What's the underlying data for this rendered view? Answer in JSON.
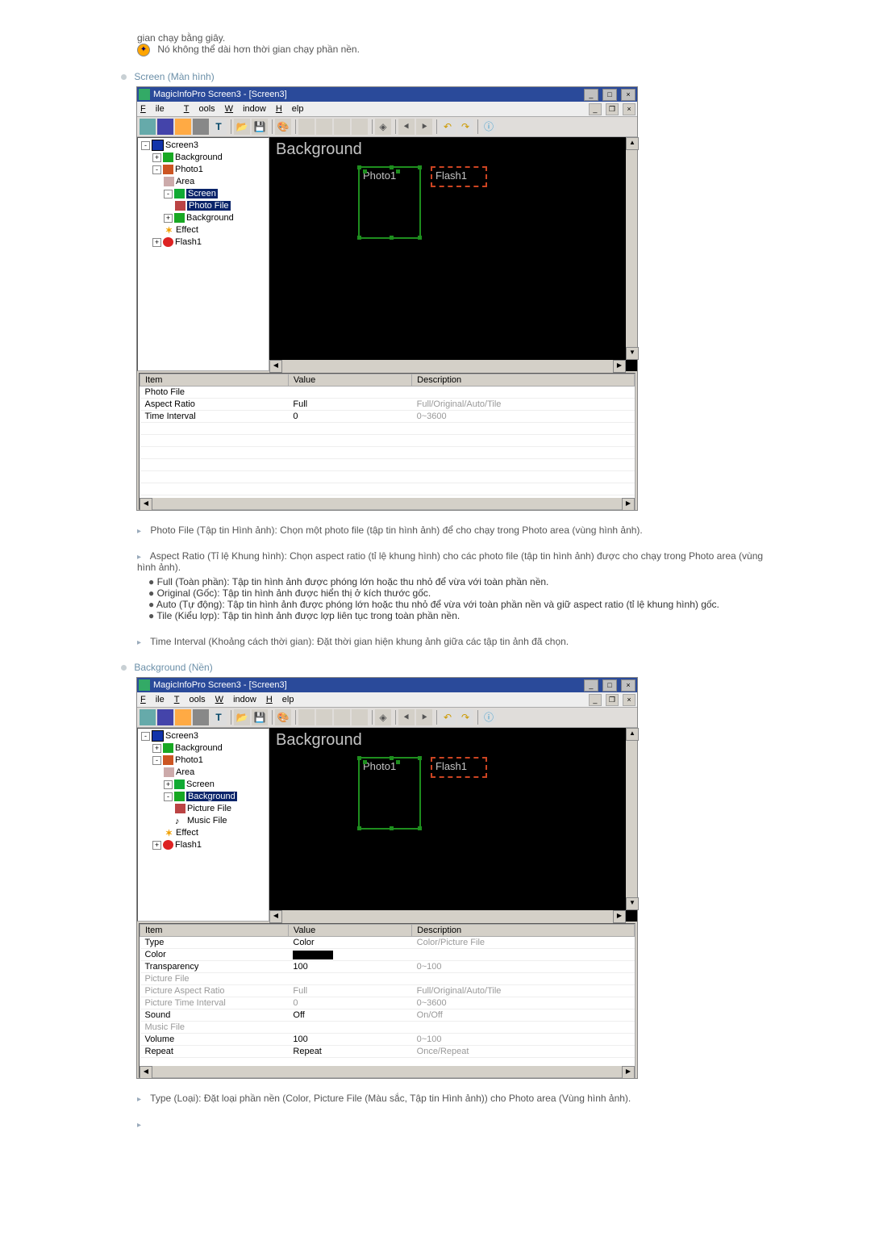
{
  "intro": {
    "line1": "gian chạy bằng giây.",
    "line2": "Nó không thể dài hơn thời gian chạy phần nền."
  },
  "sections": {
    "screen": "Screen (Màn hình)",
    "background": "Background (Nền)"
  },
  "app": {
    "title": "MagicInfoPro Screen3 - [Screen3]",
    "menus": {
      "file": "File",
      "tools": "Tools",
      "window": "Window",
      "help": "Help"
    }
  },
  "tree1": {
    "root": "Screen3",
    "bg": "Background",
    "photo1": "Photo1",
    "area": "Area",
    "screen": "Screen",
    "photofile": "Photo File",
    "bg2": "Background",
    "effect": "Effect",
    "flash1": "Flash1"
  },
  "canvas": {
    "bg": "Background",
    "photo1": "Photo1",
    "flash1": "Flash1"
  },
  "props1": {
    "headers": {
      "item": "Item",
      "value": "Value",
      "desc": "Description"
    },
    "rows": [
      {
        "item": "Photo File",
        "value": "",
        "desc": ""
      },
      {
        "item": "Aspect Ratio",
        "value": "Full",
        "desc": "Full/Original/Auto/Tile"
      },
      {
        "item": "Time Interval",
        "value": "0",
        "desc": "0~3600"
      }
    ]
  },
  "desc1": {
    "photofile": "Photo File (Tập tin Hình ảnh): Chọn một photo file (tập tin hình ảnh) để cho chạy trong Photo area (vùng hình ảnh).",
    "aspect": "Aspect Ratio (Tỉ lệ Khung hình): Chọn aspect ratio (tỉ lệ khung hình) cho các photo file (tập tin hình ảnh) được cho chạy trong Photo area (vùng hình ảnh).",
    "full": "Full (Toàn phần): Tập tin hình ảnh được phóng lớn hoặc thu nhỏ để vừa với toàn phần nền.",
    "original": "Original (Gốc): Tập tin hình ảnh được hiển thị ở kích thước gốc.",
    "auto": "Auto (Tự động): Tập tin hình ảnh được phóng lớn hoặc thu nhỏ để vừa với toàn phần nền và giữ aspect ratio (tỉ lệ khung hình) gốc.",
    "tile": "Tile (Kiểu lợp): Tập tin hình ảnh được lợp liên tục trong toàn phần nền.",
    "time": "Time Interval (Khoảng cách thời gian): Đặt thời gian hiện khung ảnh giữa các tập tin ảnh đã chọn."
  },
  "tree2": {
    "root": "Screen3",
    "bg": "Background",
    "photo1": "Photo1",
    "area": "Area",
    "screen": "Screen",
    "bgnode": "Background",
    "picfile": "Picture File",
    "musfile": "Music File",
    "effect": "Effect",
    "flash1": "Flash1"
  },
  "props2": {
    "headers": {
      "item": "Item",
      "value": "Value",
      "desc": "Description"
    },
    "rows": [
      {
        "item": "Type",
        "value": "Color",
        "desc": "Color/Picture File",
        "dis": false
      },
      {
        "item": "Color",
        "value": "",
        "desc": "",
        "color": true
      },
      {
        "item": "Transparency",
        "value": "100",
        "desc": "0~100",
        "dis": false
      },
      {
        "item": "Picture File",
        "value": "",
        "desc": "",
        "dis": true
      },
      {
        "item": "Picture Aspect Ratio",
        "value": "Full",
        "desc": "Full/Original/Auto/Tile",
        "dis": true
      },
      {
        "item": "Picture Time Interval",
        "value": "0",
        "desc": "0~3600",
        "dis": true
      },
      {
        "item": "Sound",
        "value": "Off",
        "desc": "On/Off",
        "dis": false
      },
      {
        "item": "Music File",
        "value": "",
        "desc": "",
        "dis": true
      },
      {
        "item": "Volume",
        "value": "100",
        "desc": "0~100",
        "dis": false
      },
      {
        "item": "Repeat",
        "value": "Repeat",
        "desc": "Once/Repeat",
        "dis": false
      }
    ]
  },
  "desc2": {
    "type": "Type (Loại): Đặt loại phần nền (Color, Picture File (Màu sắc, Tập tin Hình ảnh)) cho Photo area (Vùng hình ảnh)."
  }
}
